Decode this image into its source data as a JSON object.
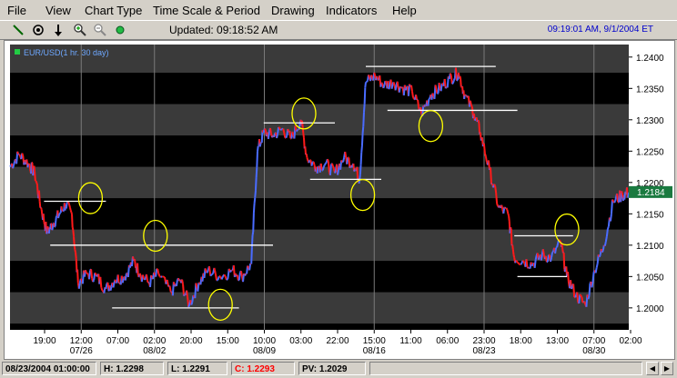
{
  "menu": {
    "items": [
      "File",
      "View",
      "Chart Type",
      "Time Scale & Period",
      "Drawing",
      "Indicators",
      "Help"
    ]
  },
  "toolbar": {
    "tools": [
      "draw-line-icon",
      "target-icon",
      "down-arrow-icon",
      "zoom-in-icon",
      "zoom-out-icon",
      "status-light-icon"
    ],
    "updated_text": "Updated: 09:18:52 AM",
    "clock_text": "09:19:01 AM, 9/1/2004 ET"
  },
  "chart": {
    "legend_text": "EUR/USD(1 hr. 30 day)",
    "current_price_label": "1.2184",
    "colors": {
      "background": "#000000",
      "band": "#3a3a3a",
      "up": "#4a6cff",
      "down": "#ff1a1a",
      "annotation_line": "#ffffff",
      "annotation_circle": "#ffff00",
      "price_tag": "#1a7a40"
    }
  },
  "chart_data": {
    "type": "line",
    "instrument": "EUR/USD",
    "ylim": [
      1.1965,
      1.242
    ],
    "y_ticks": [
      "1.2400",
      "1.2350",
      "1.2300",
      "1.2250",
      "1.2200",
      "1.2150",
      "1.2100",
      "1.2050",
      "1.2000"
    ],
    "y_tick_values": [
      1.24,
      1.235,
      1.23,
      1.225,
      1.22,
      1.215,
      1.21,
      1.205,
      1.2
    ],
    "x_tick_times": [
      "19:00",
      "12:00",
      "07:00",
      "02:00",
      "20:00",
      "15:00",
      "10:00",
      "03:00",
      "22:00",
      "15:00",
      "11:00",
      "06:00",
      "23:00",
      "18:00",
      "13:00",
      "07:00",
      "02:00"
    ],
    "x_tick_dates": [
      {
        "label": "07/26",
        "under": 1
      },
      {
        "label": "08/02",
        "under": 3
      },
      {
        "label": "08/09",
        "under": 6
      },
      {
        "label": "08/16",
        "under": 9
      },
      {
        "label": "08/23",
        "under": 12
      },
      {
        "label": "08/30",
        "under": 15
      }
    ],
    "price_path": [
      [
        0,
        1.2225
      ],
      [
        0.015,
        1.2245
      ],
      [
        0.03,
        1.223
      ],
      [
        0.04,
        1.2215
      ],
      [
        0.05,
        1.216
      ],
      [
        0.06,
        1.212
      ],
      [
        0.07,
        1.2135
      ],
      [
        0.08,
        1.215
      ],
      [
        0.09,
        1.2165
      ],
      [
        0.1,
        1.215
      ],
      [
        0.11,
        1.204
      ],
      [
        0.125,
        1.2055
      ],
      [
        0.14,
        1.205
      ],
      [
        0.155,
        1.203
      ],
      [
        0.17,
        1.2045
      ],
      [
        0.185,
        1.205
      ],
      [
        0.2,
        1.2075
      ],
      [
        0.21,
        1.2055
      ],
      [
        0.225,
        1.204
      ],
      [
        0.24,
        1.2055
      ],
      [
        0.26,
        1.2025
      ],
      [
        0.275,
        1.2045
      ],
      [
        0.29,
        1.2005
      ],
      [
        0.305,
        1.204
      ],
      [
        0.32,
        1.206
      ],
      [
        0.34,
        1.205
      ],
      [
        0.36,
        1.206
      ],
      [
        0.375,
        1.205
      ],
      [
        0.39,
        1.207
      ],
      [
        0.4,
        1.225
      ],
      [
        0.41,
        1.228
      ],
      [
        0.425,
        1.2275
      ],
      [
        0.44,
        1.2285
      ],
      [
        0.455,
        1.227
      ],
      [
        0.47,
        1.23
      ],
      [
        0.48,
        1.224
      ],
      [
        0.495,
        1.2225
      ],
      [
        0.51,
        1.223
      ],
      [
        0.525,
        1.2215
      ],
      [
        0.54,
        1.224
      ],
      [
        0.555,
        1.223
      ],
      [
        0.565,
        1.2205
      ],
      [
        0.575,
        1.236
      ],
      [
        0.59,
        1.237
      ],
      [
        0.605,
        1.2355
      ],
      [
        0.62,
        1.236
      ],
      [
        0.635,
        1.235
      ],
      [
        0.65,
        1.2345
      ],
      [
        0.665,
        1.231
      ],
      [
        0.68,
        1.234
      ],
      [
        0.695,
        1.235
      ],
      [
        0.71,
        1.2365
      ],
      [
        0.725,
        1.2375
      ],
      [
        0.735,
        1.234
      ],
      [
        0.75,
        1.231
      ],
      [
        0.76,
        1.228
      ],
      [
        0.775,
        1.222
      ],
      [
        0.79,
        1.216
      ],
      [
        0.805,
        1.215
      ],
      [
        0.815,
        1.208
      ],
      [
        0.83,
        1.2075
      ],
      [
        0.845,
        1.207
      ],
      [
        0.86,
        1.2085
      ],
      [
        0.875,
        1.208
      ],
      [
        0.89,
        1.2105
      ],
      [
        0.9,
        1.205
      ],
      [
        0.915,
        1.202
      ],
      [
        0.93,
        1.2005
      ],
      [
        0.945,
        1.206
      ],
      [
        0.96,
        1.21
      ],
      [
        0.975,
        1.217
      ],
      [
        0.99,
        1.218
      ],
      [
        1,
        1.2184
      ]
    ],
    "support_resistance_lines": [
      {
        "y": 1.217,
        "x0": 0.055,
        "x1": 0.155
      },
      {
        "y": 1.21,
        "x0": 0.065,
        "x1": 0.425
      },
      {
        "y": 1.2,
        "x0": 0.165,
        "x1": 0.37
      },
      {
        "y": 1.2295,
        "x0": 0.41,
        "x1": 0.525
      },
      {
        "y": 1.2205,
        "x0": 0.485,
        "x1": 0.6
      },
      {
        "y": 1.2385,
        "x0": 0.575,
        "x1": 0.785
      },
      {
        "y": 1.2315,
        "x0": 0.61,
        "x1": 0.82
      },
      {
        "y": 1.2115,
        "x0": 0.815,
        "x1": 0.91
      },
      {
        "y": 1.205,
        "x0": 0.82,
        "x1": 0.9
      }
    ],
    "highlight_circles": [
      {
        "x": 0.13,
        "y": 1.2175
      },
      {
        "x": 0.235,
        "y": 1.2115
      },
      {
        "x": 0.34,
        "y": 1.2005
      },
      {
        "x": 0.475,
        "y": 1.231
      },
      {
        "x": 0.57,
        "y": 1.218
      },
      {
        "x": 0.68,
        "y": 1.229
      },
      {
        "x": 0.9,
        "y": 1.2125
      }
    ]
  },
  "statusbar": {
    "date": "08/23/2004 01:00:00",
    "high": "H: 1.2298",
    "low": "L: 1.2291",
    "close": "C: 1.2293",
    "pv": "PV: 1.2029",
    "close_color": "#ff0000"
  }
}
